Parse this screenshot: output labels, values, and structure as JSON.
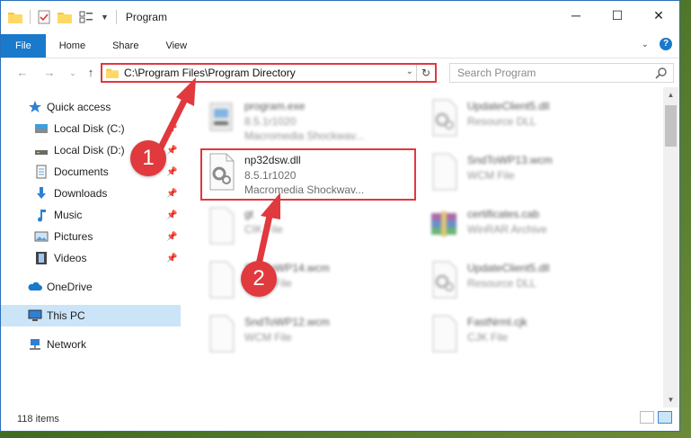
{
  "window": {
    "title": "Program",
    "controls": {
      "minimize": "─",
      "maximize": "☐",
      "close": "✕"
    }
  },
  "ribbon": {
    "tabs": [
      "File",
      "Home",
      "Share",
      "View"
    ]
  },
  "address_bar": {
    "path": "C:\\Program Files\\Program Directory"
  },
  "search": {
    "placeholder": "Search Program"
  },
  "sidebar": {
    "items": [
      {
        "label": "Quick access",
        "icon": "star-icon"
      },
      {
        "label": "Local Disk (C:)",
        "icon": "drive-icon"
      },
      {
        "label": "Local Disk (D:)",
        "icon": "drive-icon"
      },
      {
        "label": "Documents",
        "icon": "documents-icon"
      },
      {
        "label": "Downloads",
        "icon": "download-icon"
      },
      {
        "label": "Music",
        "icon": "music-icon"
      },
      {
        "label": "Pictures",
        "icon": "pictures-icon"
      },
      {
        "label": "Videos",
        "icon": "videos-icon"
      },
      {
        "label": "OneDrive",
        "icon": "cloud-icon"
      },
      {
        "label": "This PC",
        "icon": "computer-icon"
      },
      {
        "label": "Network",
        "icon": "network-icon"
      }
    ]
  },
  "files": [
    {
      "name": "program.exe",
      "version": "8.5.1r1020",
      "type": "Macromedia Shockwav...",
      "icon": "exe-icon"
    },
    {
      "name": "UpdateClient5.dll",
      "version": "",
      "type": "Resource DLL",
      "icon": "dll-icon"
    },
    {
      "name": "np32dsw.dll",
      "version": "8.5.1r1020",
      "type": "Macromedia Shockwav...",
      "icon": "dll-gear-icon"
    },
    {
      "name": "SndToWP13.wcm",
      "version": "",
      "type": "WCM File",
      "icon": "file-icon"
    },
    {
      "name": "gt",
      "version": "",
      "type": "CIK File",
      "icon": "file-icon"
    },
    {
      "name": "certificates.cab",
      "version": "",
      "type": "WinRAR Archive",
      "icon": "archive-icon"
    },
    {
      "name": "SndToWP14.wcm",
      "version": "",
      "type": "WCM File",
      "icon": "file-icon"
    },
    {
      "name": "UpdateClient5.dll",
      "version": "",
      "type": "Resource DLL",
      "icon": "dll-icon"
    },
    {
      "name": "SndToWP12.wcm",
      "version": "",
      "type": "WCM File",
      "icon": "file-icon"
    },
    {
      "name": "FastNrml.cjk",
      "version": "",
      "type": "CJK File",
      "icon": "file-icon"
    }
  ],
  "status": {
    "item_count": "118 items"
  },
  "annotations": {
    "step1": "1",
    "step2": "2"
  },
  "colors": {
    "accent": "#1979ca",
    "highlight": "#e0393e",
    "selection": "#cce4f7"
  }
}
